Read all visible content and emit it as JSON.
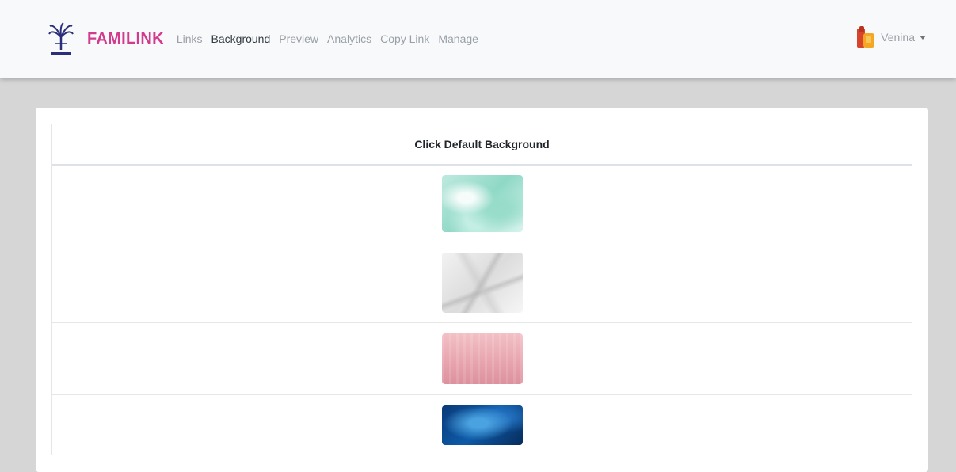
{
  "header": {
    "brand": "FAMILINK",
    "logo_icon": "palm-tree-logo-icon",
    "nav": [
      {
        "label": "Links",
        "active": false
      },
      {
        "label": "Background",
        "active": true
      },
      {
        "label": "Preview",
        "active": false
      },
      {
        "label": "Analytics",
        "active": false
      },
      {
        "label": "Copy Link",
        "active": false
      },
      {
        "label": "Manage",
        "active": false
      }
    ],
    "user": {
      "name": "Venina",
      "avatar_icon": "user-avatar-icon"
    }
  },
  "background_table": {
    "heading": "Click Default Background",
    "options": [
      {
        "name": "mint-marble",
        "color": "#a8e2d4"
      },
      {
        "name": "white-crumpled-paper",
        "color": "#e6e6e6"
      },
      {
        "name": "pink-texture",
        "color": "#e9a9b3"
      },
      {
        "name": "blue-texture",
        "color": "#0e4f96"
      }
    ]
  },
  "colors": {
    "brand": "#d33a8c",
    "nav_inactive": "#9aa0a6",
    "nav_active": "#343a40",
    "page_bg": "#d6d6d6"
  }
}
